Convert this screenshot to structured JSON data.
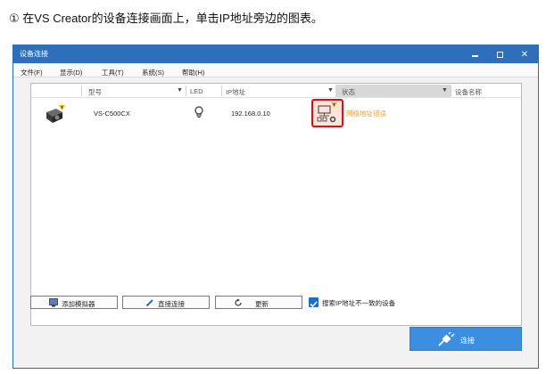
{
  "instruction": "① 在VS Creator的设备连接画面上，单击IP地址旁边的图表。",
  "window": {
    "title": "设备连接"
  },
  "menu": [
    "文件(F)",
    "显示(D)",
    "工具(T)",
    "系统(S)",
    "帮助(H)"
  ],
  "columns": {
    "model": "型号",
    "led": "LED",
    "ip": "IP地址",
    "status": "状态",
    "device_name": "设备名称"
  },
  "device": {
    "model": "VS-C500CX",
    "ip": "192.168.0.10",
    "status_text": "网络地址错误"
  },
  "buttons": {
    "add_simulator": "添加模拟器",
    "direct_connect": "直接连接",
    "refresh": "更新",
    "connect": "连接"
  },
  "checkbox": {
    "label": "搜索IP地址不一致的设备",
    "checked": true
  },
  "colors": {
    "title_bar": "#2f6fb9",
    "highlight_box": "#d4121c",
    "warning_text": "#e6a23c",
    "connect_button": "#3c8fe0"
  }
}
